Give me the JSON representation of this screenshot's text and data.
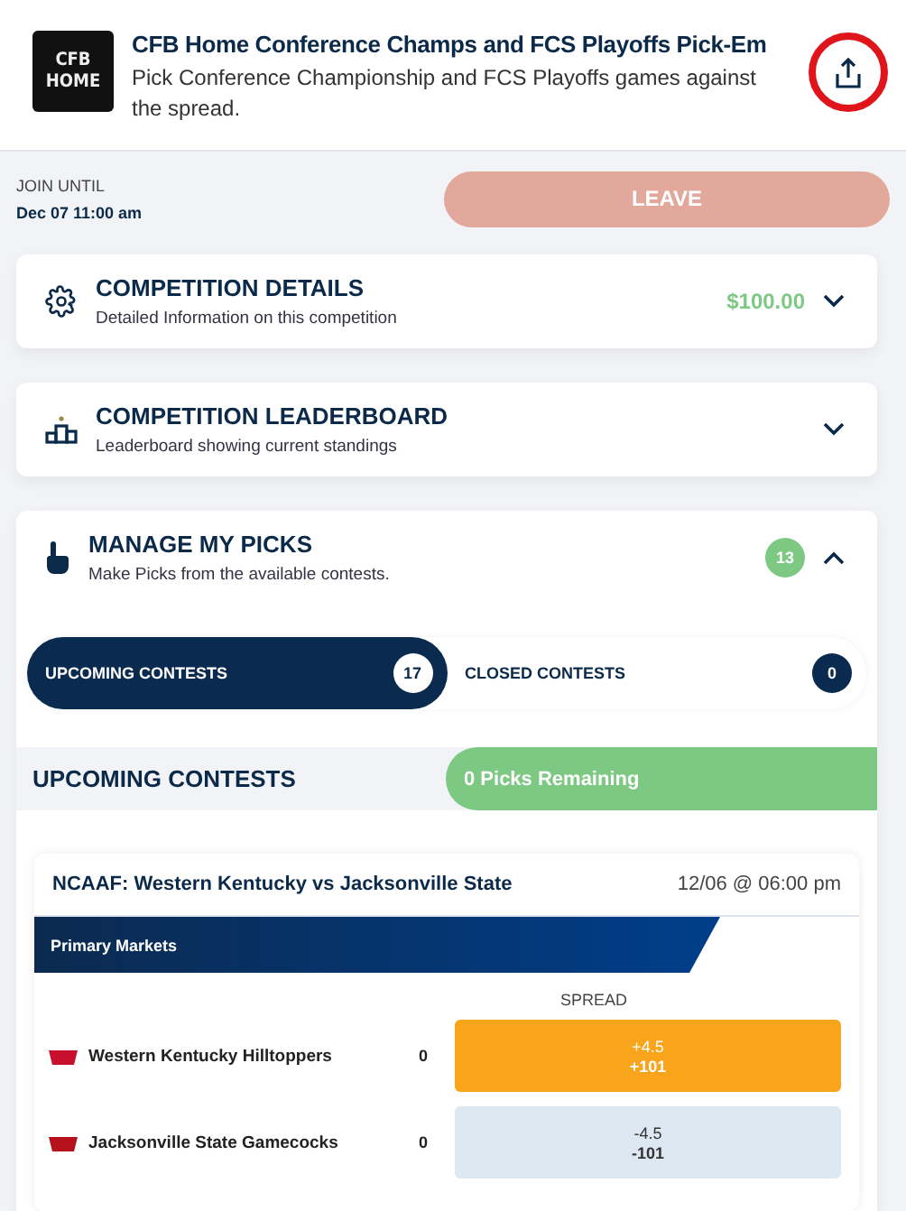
{
  "header": {
    "logo_lines": [
      "CFB",
      "HOME"
    ],
    "title": "CFB Home Conference Champs and FCS Playoffs Pick-Em",
    "description": "Pick Conference Championship and FCS Playoffs games against the spread.",
    "share_highlighted": true
  },
  "join": {
    "label": "JOIN UNTIL",
    "date": "Dec 07 11:00 am",
    "button": "LEAVE",
    "disabled": true
  },
  "sections": [
    {
      "kind": "details",
      "title": "COMPETITION DETAILS",
      "subtitle": "Detailed Information on this competition",
      "value": "$100.00",
      "expanded": false
    },
    {
      "kind": "leaderboard",
      "title": "COMPETITION LEADERBOARD",
      "subtitle": "Leaderboard showing current standings",
      "expanded": false
    },
    {
      "kind": "picks",
      "title": "MANAGE MY PICKS",
      "subtitle": "Make Picks from the available contests.",
      "badge": "13",
      "expanded": true
    }
  ],
  "contest_tabs": [
    {
      "label": "UPCOMING CONTESTS",
      "count": "17",
      "selected": true
    },
    {
      "label": "CLOSED CONTESTS",
      "count": "0",
      "selected": false
    }
  ],
  "list_header": {
    "title": "UPCOMING CONTESTS",
    "remaining": "0 Picks Remaining"
  },
  "game": {
    "title": "NCAAF: Western Kentucky vs Jacksonville State",
    "time": "12/06 @ 06:00 pm",
    "market": "Primary Markets",
    "column": "SPREAD",
    "teams": [
      {
        "name": "Western Kentucky Hilltoppers",
        "score": "0",
        "line": "+4.5",
        "odds": "+101",
        "selected": true,
        "color": "#c8102e"
      },
      {
        "name": "Jacksonville State Gamecocks",
        "score": "0",
        "line": "-4.5",
        "odds": "-101",
        "selected": false,
        "color": "#b5121b"
      }
    ]
  }
}
